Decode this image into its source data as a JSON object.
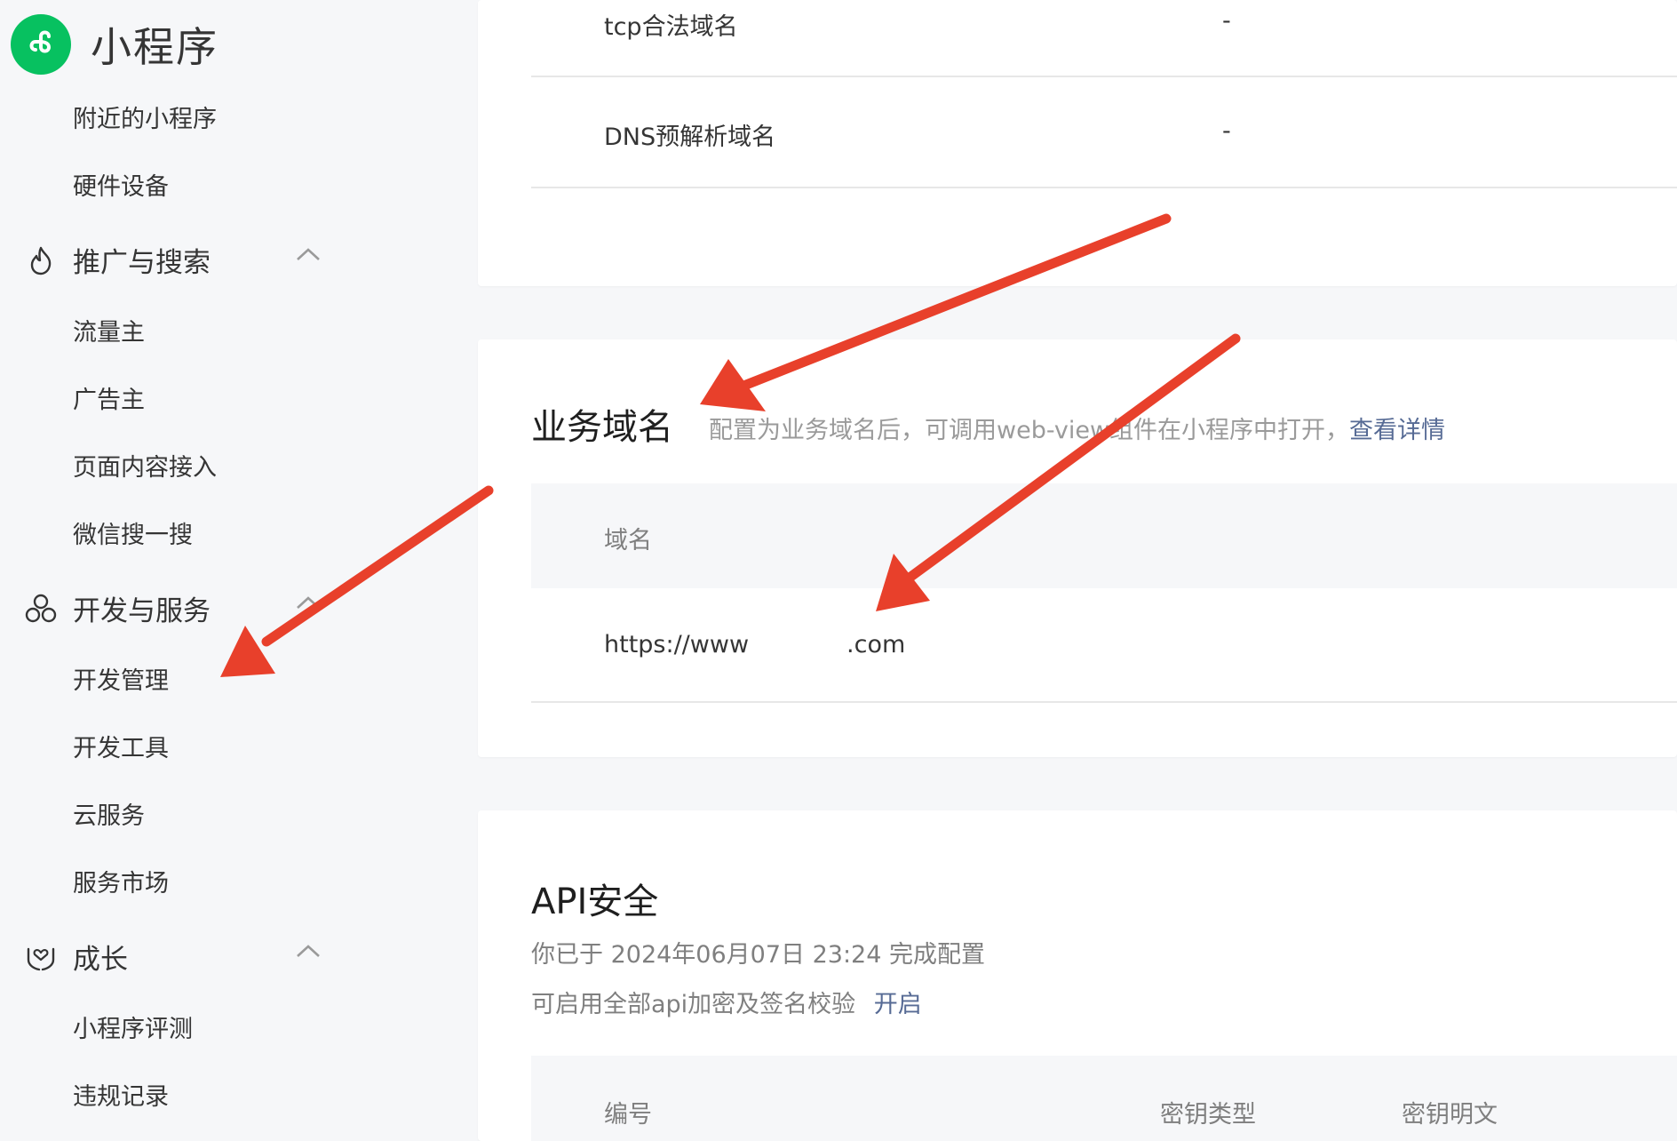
{
  "brand": {
    "title": "小程序"
  },
  "sidebar": {
    "top_items": [
      "附近的小程序",
      "硬件设备"
    ],
    "groups": [
      {
        "label": "推广与搜索",
        "icon": "flame-icon",
        "items": [
          "流量主",
          "广告主",
          "页面内容接入",
          "微信搜一搜"
        ]
      },
      {
        "label": "开发与服务",
        "icon": "hexagons-icon",
        "items": [
          "开发管理",
          "开发工具",
          "云服务",
          "服务市场"
        ]
      },
      {
        "label": "成长",
        "icon": "hands-heart-icon",
        "items": [
          "小程序评测",
          "违规记录"
        ]
      }
    ]
  },
  "server_domains": {
    "rows": [
      {
        "label": "tcp合法域名",
        "value": "-"
      },
      {
        "label": "DNS预解析域名",
        "value": "-"
      }
    ]
  },
  "business_domain": {
    "title": "业务域名",
    "desc_before": "配置为业务域名后，可调用web-view组件在小程序中打开，",
    "desc_link": "查看详情",
    "column_header": "域名",
    "url_prefix": "https://www",
    "url_suffix": ".com"
  },
  "api_security": {
    "title": "API安全",
    "configured_text": "你已于 2024年06月07日 23:24 完成配置",
    "enable_text": "可启用全部api加密及签名校验",
    "enable_link": "开启",
    "columns": [
      "编号",
      "密钥类型",
      "密钥明文"
    ]
  },
  "colors": {
    "brand_green": "#07c160",
    "link_blue": "#576b95",
    "annotation_red": "#e8402b"
  }
}
